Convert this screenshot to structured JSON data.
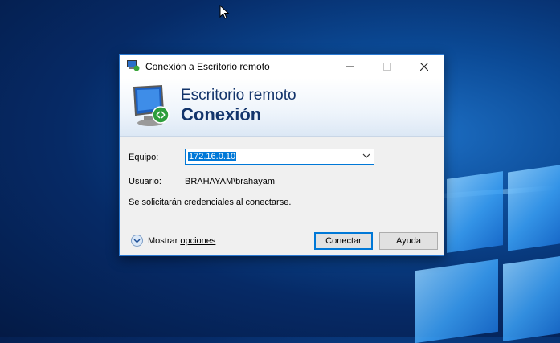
{
  "window": {
    "title": "Conexión a Escritorio remoto",
    "accent": "#0078d7"
  },
  "banner": {
    "line1": "Escritorio remoto",
    "line2": "Conexión"
  },
  "form": {
    "computer_label": "Equipo:",
    "computer_value": "172.16.0.10",
    "user_label": "Usuario:",
    "user_value": "BRAHAYAM\\brahayam",
    "info": "Se solicitarán credenciales al conectarse."
  },
  "footer": {
    "options_prefix": "Mostrar ",
    "options_underlined": "opciones",
    "connect_label": "Conectar",
    "help_label": "Ayuda"
  },
  "icons": [
    "remote-desktop-icon",
    "minimize-icon",
    "maximize-icon",
    "close-icon",
    "monitor-connection-icon",
    "chevron-down-icon",
    "expand-options-icon",
    "mouse-cursor-icon"
  ]
}
